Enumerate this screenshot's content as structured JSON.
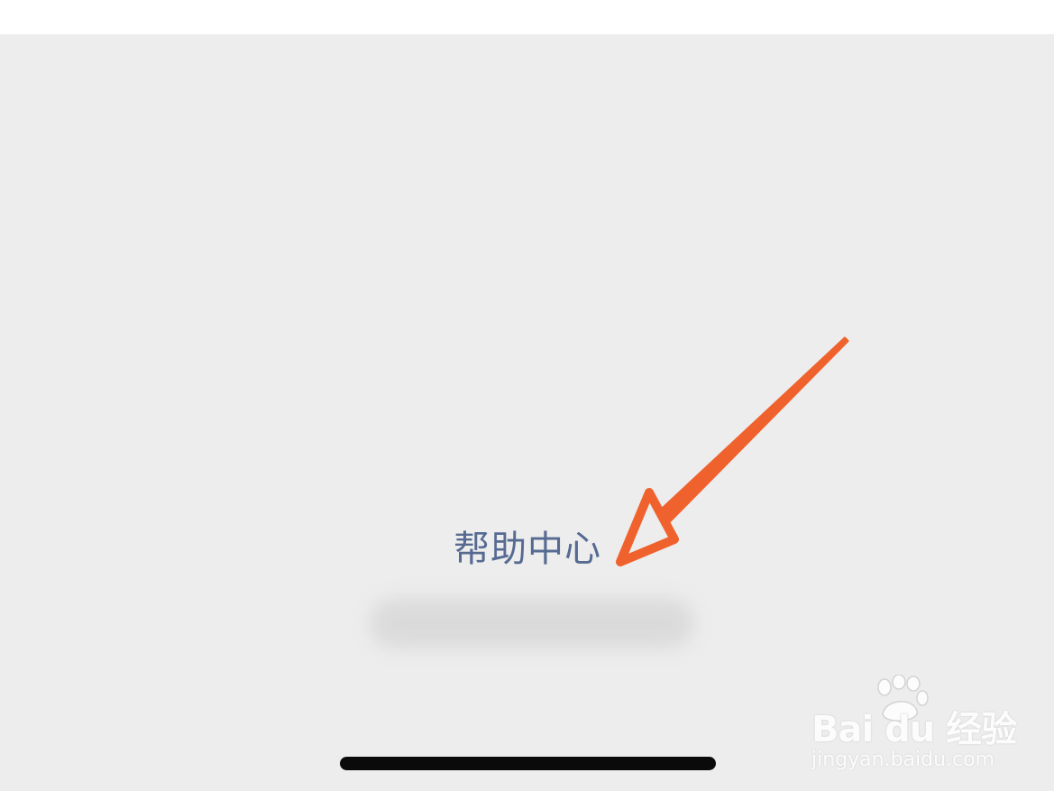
{
  "help_center": {
    "label": "帮助中心"
  },
  "annotation": {
    "type": "arrow",
    "color": "#f0622d"
  },
  "home_indicator": {
    "color": "#0a0a0a"
  },
  "watermark": {
    "logo_text": "Bai du 经验",
    "url": "jingyan.baidu.com"
  },
  "colors": {
    "background": "#ededed",
    "link": "#566a92",
    "arrow": "#f0622d"
  }
}
